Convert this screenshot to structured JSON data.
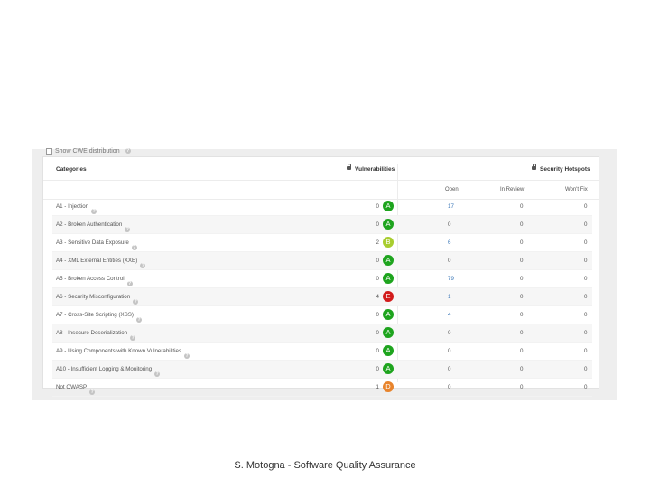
{
  "cwe_toggle_label": "Show CWE distribution",
  "headers": {
    "categories": "Categories",
    "vulnerabilities": "Vulnerabilities",
    "security_hotspots": "Security Hotspots",
    "open": "Open",
    "in_review": "In Review",
    "wont_fix": "Won't Fix"
  },
  "rows": [
    {
      "category": "A1 - Injection",
      "vulns": "0",
      "rating": "A",
      "open": "17",
      "in_review": "0",
      "wont_fix": "0"
    },
    {
      "category": "A2 - Broken Authentication",
      "vulns": "0",
      "rating": "A",
      "open": "0",
      "in_review": "0",
      "wont_fix": "0"
    },
    {
      "category": "A3 - Sensitive Data Exposure",
      "vulns": "2",
      "rating": "B",
      "open": "6",
      "in_review": "0",
      "wont_fix": "0"
    },
    {
      "category": "A4 - XML External Entities (XXE)",
      "vulns": "0",
      "rating": "A",
      "open": "0",
      "in_review": "0",
      "wont_fix": "0"
    },
    {
      "category": "A5 - Broken Access Control",
      "vulns": "0",
      "rating": "A",
      "open": "79",
      "in_review": "0",
      "wont_fix": "0"
    },
    {
      "category": "A6 - Security Misconfiguration",
      "vulns": "4",
      "rating": "E",
      "open": "1",
      "in_review": "0",
      "wont_fix": "0"
    },
    {
      "category": "A7 - Cross-Site Scripting (XSS)",
      "vulns": "0",
      "rating": "A",
      "open": "4",
      "in_review": "0",
      "wont_fix": "0"
    },
    {
      "category": "A8 - Insecure Deserialization",
      "vulns": "0",
      "rating": "A",
      "open": "0",
      "in_review": "0",
      "wont_fix": "0"
    },
    {
      "category": "A9 - Using Components with Known Vulnerabilities",
      "vulns": "0",
      "rating": "A",
      "open": "0",
      "in_review": "0",
      "wont_fix": "0"
    },
    {
      "category": "A10 - Insufficient Logging & Monitoring",
      "vulns": "0",
      "rating": "A",
      "open": "0",
      "in_review": "0",
      "wont_fix": "0"
    },
    {
      "category": "Not OWASP",
      "vulns": "1",
      "rating": "D",
      "open": "0",
      "in_review": "0",
      "wont_fix": "0"
    }
  ],
  "rating_colors": {
    "A": "#1ea41e",
    "B": "#a8cd2f",
    "D": "#e8842c",
    "E": "#d21c1c"
  },
  "link_color": "#3c78b8",
  "caption": "S. Motogna - Software Quality Assurance"
}
